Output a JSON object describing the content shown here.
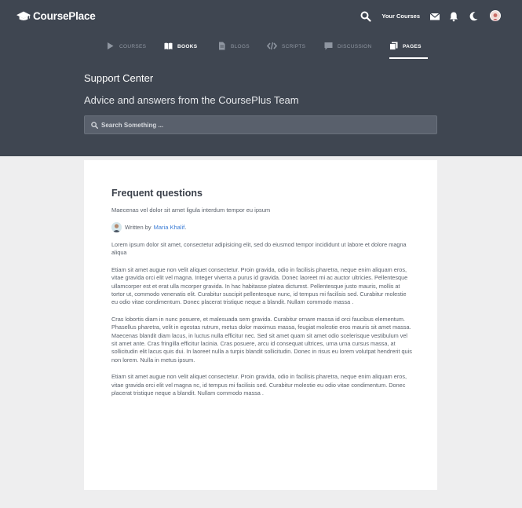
{
  "brand": {
    "name": "CoursePlace"
  },
  "topbar": {
    "your_courses": "Your Courses",
    "icons": [
      "search-icon",
      "mail-icon",
      "bell-icon",
      "moon-icon",
      "avatar"
    ]
  },
  "tabs": [
    {
      "label": "COURSES",
      "icon": "play-icon"
    },
    {
      "label": "BOOKS",
      "icon": "book-icon"
    },
    {
      "label": "BLOGS",
      "icon": "file-icon"
    },
    {
      "label": "SCRIPTS",
      "icon": "code-icon"
    },
    {
      "label": "DISCUSSION",
      "icon": "comment-icon"
    },
    {
      "label": "PAGES",
      "icon": "pages-icon",
      "active": true
    }
  ],
  "hero": {
    "title": "Support Center",
    "subtitle": "Advice and answers from the CoursePlus Team",
    "search_placeholder": "Search Something ..."
  },
  "article": {
    "title": "Frequent questions",
    "subtitle": "Maecenas vel dolor sit amet ligula interdum tempor eu ipsum",
    "written_by": "Written by",
    "author": "Maria Khalif",
    "paragraphs": [
      "Lorem ipsum dolor sit amet, consectetur adipisicing elit, sed do eiusmod tempor incididunt ut labore et dolore magna aliqua",
      "Etiam sit amet augue non velit aliquet consectetur. Proin gravida, odio in facilisis pharetra, neque enim aliquam eros, vitae gravida orci elit vel magna. Integer viverra a purus id gravida. Donec laoreet mi ac auctor ultricies. Pellentesque ullamcorper est et erat ulla mcorper gravida. In hac habitasse platea dictumst. Pellentesque justo mauris, mollis at tortor ut, commodo venenatis elit. Curabitur suscipit pellentesque nunc, id tempus mi facilisis sed. Curabitur molestie eu odio vitae condimentum. Donec placerat tristique neque a blandit. Nullam commodo massa .",
      "Cras lobortis diam in nunc posuere, et malesuada sem gravida. Curabitur ornare massa id orci faucibus elementum. Phasellus pharetra, velit in egestas rutrum, metus dolor maximus massa, feugiat molestie eros mauris sit amet massa. Maecenas blandit diam lacus, in luctus nulla efficitur nec. Sed sit amet quam sit amet odio scelerisque vestibulum vel sit amet ante. Cras fringilla efficitur lacinia. Cras posuere, arcu id consequat ultrices, urna urna cursus massa, at sollicitudin elit lacus quis dui. In laoreet nulla a turpis blandit sollicitudin. Donec in risus eu lorem volutpat hendrerit quis non lorem. Nulla in metus ipsum.",
      "Etiam sit amet augue non velit aliquet consectetur. Proin gravida, odio in facilisis pharetra, neque enim aliquam eros, vitae gravida orci elit vel magna nc, id tempus mi facilisis sed. Curabitur molestie eu odio vitae condimentum. Donec placerat tristique neque a blandit. Nullam commodo massa ."
    ]
  },
  "colors": {
    "header_bg": "#3f4651",
    "page_bg": "#eeeeef",
    "link": "#3a7bd5",
    "tab_inactive": "#8f96a1"
  }
}
